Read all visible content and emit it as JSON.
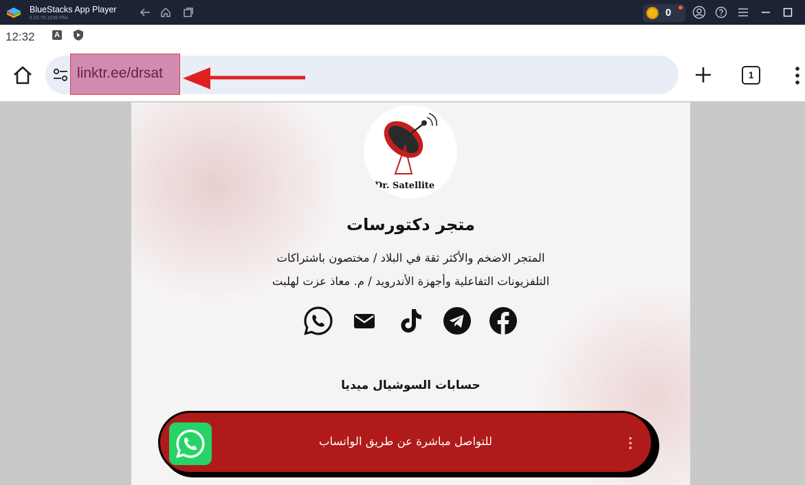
{
  "emulator": {
    "app_name": "BlueStacks App Player",
    "version": "5.22.70.1039  P64",
    "coins": "0",
    "icons": [
      "back-icon",
      "home-icon",
      "multi-instance-icon",
      "account-icon",
      "help-icon",
      "hamburger-icon",
      "minimize-icon",
      "maximize-icon"
    ]
  },
  "status_bar": {
    "time": "12:32",
    "indicator_a": "A"
  },
  "browser": {
    "url": "linktr.ee/drsat",
    "tab_count": "1",
    "annotation": {
      "type": "arrow",
      "color": "#e02020",
      "points_to": "url"
    }
  },
  "profile": {
    "logo_caption": "Dr. Satellite",
    "title": "متجر دكتورسات",
    "bio_line1": "المتجر الاضخم والأكثر ثقة في البلاد / مختصون باشتراكات",
    "bio_line2": "التلفزيونات التفاعلية وأجهزة الأندرويد / م. معاذ عزت لهلبت",
    "social_icons": [
      "whatsapp-icon",
      "email-icon",
      "tiktok-icon",
      "telegram-icon",
      "facebook-icon"
    ]
  },
  "section": {
    "heading": "حسابات السوشيال ميديا"
  },
  "links": [
    {
      "label": "للتواصل مباشرة عن طريق الواتساب",
      "icon": "whatsapp-icon",
      "color": "#b01a1a"
    }
  ]
}
